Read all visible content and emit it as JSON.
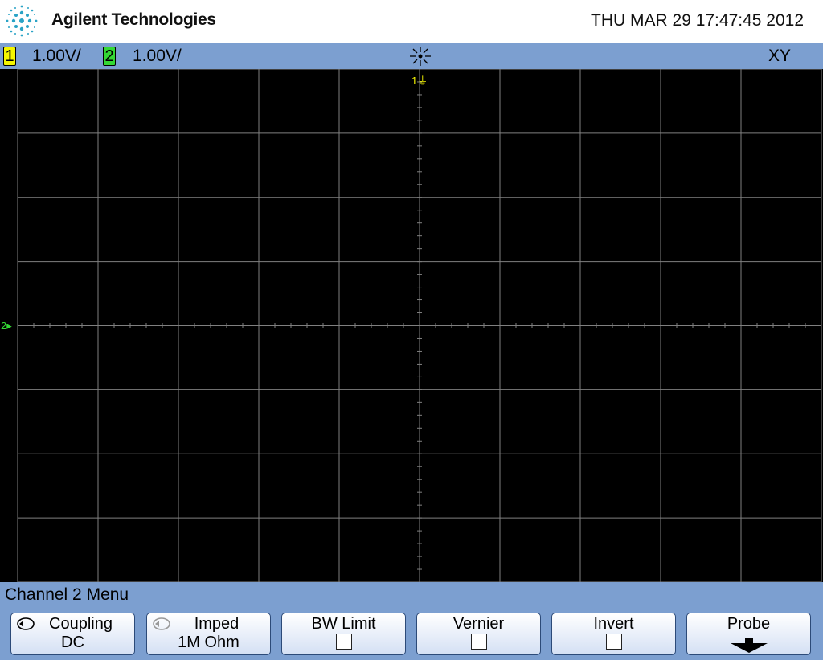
{
  "header": {
    "brand": "Agilent Technologies",
    "datetime": "THU MAR 29 17:47:45 2012"
  },
  "status": {
    "ch1": {
      "number": "1",
      "scale": "1.00V/",
      "color": "#f5f500"
    },
    "ch2": {
      "number": "2",
      "scale": "1.00V/",
      "color": "#34d834"
    },
    "run_icon": "stopped-starburst-icon",
    "mode": "XY"
  },
  "screen": {
    "ch1_marker": "1",
    "ch2_marker": "2",
    "grid_color": "#808080",
    "background": "#000000"
  },
  "menu": {
    "title": "Channel 2  Menu",
    "softkeys": [
      {
        "label": "Coupling",
        "value": "DC",
        "icon": "cycle-icon",
        "enabled": true
      },
      {
        "label": "Imped",
        "value": "1M Ohm",
        "icon": "cycle-icon",
        "enabled": false
      },
      {
        "label": "BW Limit",
        "value": "",
        "checkbox": false
      },
      {
        "label": "Vernier",
        "value": "",
        "checkbox": false
      },
      {
        "label": "Invert",
        "value": "",
        "checkbox": false
      },
      {
        "label": "Probe",
        "value": "",
        "icon": "arrow-down-icon"
      }
    ]
  }
}
